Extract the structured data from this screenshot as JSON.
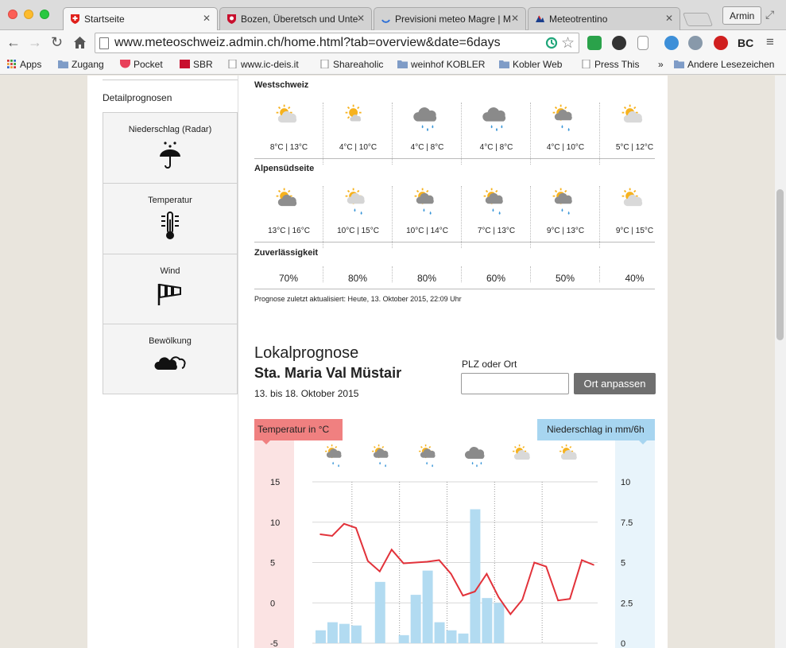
{
  "browser": {
    "tabs": [
      {
        "label": "Startseite",
        "active": true
      },
      {
        "label": "Bozen, Überetsch und Unte",
        "active": false
      },
      {
        "label": "Previsioni meteo Magre | M",
        "active": false
      },
      {
        "label": "Meteotrentino",
        "active": false
      }
    ],
    "user_label": "Armin",
    "url": "www.meteoschweiz.admin.ch/home.html?tab=overview&date=6days",
    "ext_label": "BC",
    "bookmarks": [
      "Apps",
      "Zugang",
      "Pocket",
      "SBR",
      "www.ic-deis.it",
      "Shareaholic",
      "weinhof KOBLER",
      "Kobler Web",
      "Press This",
      "»",
      "Andere Lesezeichen"
    ]
  },
  "sidebar": {
    "title": "Detailprognosen",
    "items": [
      {
        "label": "Niederschlag (Radar)",
        "icon": "umbrella-rain-icon"
      },
      {
        "label": "Temperatur",
        "icon": "thermometer-icon"
      },
      {
        "label": "Wind",
        "icon": "windsock-icon"
      },
      {
        "label": "Bewölkung",
        "icon": "clouds-icon"
      }
    ]
  },
  "forecast": {
    "regions": [
      {
        "name": "Westschweiz",
        "days": [
          {
            "icon": "sun-cloud-light",
            "temp": "8°C | 13°C"
          },
          {
            "icon": "sun-cloud-small",
            "temp": "4°C | 10°C"
          },
          {
            "icon": "cloud-rain",
            "temp": "4°C | 8°C"
          },
          {
            "icon": "cloud-rain",
            "temp": "4°C | 8°C"
          },
          {
            "icon": "sun-cloud-rain",
            "temp": "4°C | 10°C"
          },
          {
            "icon": "sun-cloud-light",
            "temp": "5°C | 12°C"
          }
        ]
      },
      {
        "name": "Alpensüdseite",
        "days": [
          {
            "icon": "sun-cloud-dark",
            "temp": "13°C | 16°C"
          },
          {
            "icon": "sun-cloud-rain-light",
            "temp": "10°C | 15°C"
          },
          {
            "icon": "sun-cloud-rain",
            "temp": "10°C | 14°C"
          },
          {
            "icon": "sun-cloud-rain",
            "temp": "7°C | 13°C"
          },
          {
            "icon": "sun-cloud-rain",
            "temp": "9°C | 13°C"
          },
          {
            "icon": "sun-cloud-light",
            "temp": "9°C | 15°C"
          }
        ]
      }
    ],
    "reliability_title": "Zuverlässigkeit",
    "reliability": [
      "70%",
      "80%",
      "80%",
      "60%",
      "50%",
      "40%"
    ],
    "updated": "Prognose zuletzt aktualisiert: Heute, 13. Oktober 2015, 22:09 Uhr"
  },
  "local": {
    "heading": "Lokalprognose",
    "place": "Sta. Maria Val Müstair",
    "dates": "13. bis 18. Oktober 2015",
    "plz_label": "PLZ oder Ort",
    "plz_value": "",
    "button": "Ort anpassen",
    "temp_label": "Temperatur in °C",
    "precip_label": "Niederschlag in mm/6h"
  },
  "chart_data": {
    "type": "line",
    "title": "",
    "day_icons": [
      "sun-cloud-rain",
      "sun-cloud-rain",
      "sun-cloud-rain",
      "cloud-rain",
      "sun-cloud-light",
      "sun-cloud-light"
    ],
    "temp_axis": {
      "ticks": [
        "15",
        "10",
        "5",
        "0",
        "-5"
      ],
      "ylim": [
        -5,
        15
      ]
    },
    "precip_axis": {
      "ticks": [
        "10",
        "7.5",
        "5",
        "2.5",
        "0"
      ],
      "ylim": [
        0,
        10
      ]
    },
    "temperature": [
      8.5,
      8.3,
      9.8,
      9.3,
      5.2,
      3.9,
      6.6,
      4.9,
      5.0,
      5.1,
      5.3,
      3.6,
      0.9,
      1.4,
      3.6,
      0.7,
      -1.4,
      0.4,
      5.0,
      4.5,
      0.3,
      0.5,
      5.3,
      4.7
    ],
    "precipitation": [
      0.8,
      1.3,
      1.2,
      1.1,
      0.0,
      3.8,
      0.0,
      0.5,
      3.0,
      4.5,
      1.3,
      0.8,
      0.6,
      8.3,
      2.8,
      2.5,
      0.0,
      0.0,
      0.0,
      0.0,
      0.0,
      0.0,
      0.0,
      0.0
    ]
  }
}
